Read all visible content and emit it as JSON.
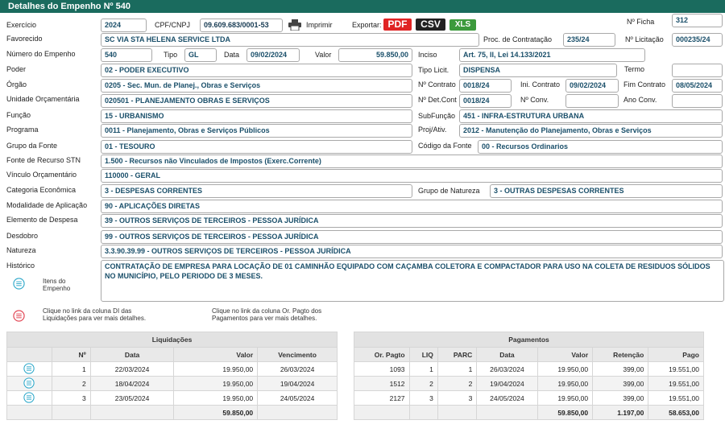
{
  "header": {
    "title": "Detalhes do Empenho Nº 540"
  },
  "row1": {
    "exercicio_label": "Exercício",
    "exercicio": "2024",
    "cnpj_label": "CPF/CNPJ",
    "cnpj": "09.609.683/0001-53",
    "imprimir": "Imprimir",
    "exportar": "Exportar:",
    "pdf": "PDF",
    "csv": "CSV",
    "xls": "XLS",
    "ficha_label": "Nº Ficha",
    "ficha": "312"
  },
  "row2": {
    "favorecido_label": "Favorecido",
    "favorecido": "SC VIA STA HELENA SERVICE LTDA",
    "proc_label": "Proc. de Contratação",
    "proc": "235/24",
    "licitacao_label": "Nº Licitação",
    "licitacao": "000235/24"
  },
  "row3": {
    "num_label": "Número do Empenho",
    "num": "540",
    "tipo_label": "Tipo",
    "tipo": "GL",
    "data_label": "Data",
    "data": "09/02/2024",
    "valor_label": "Valor",
    "valor": "59.850,00",
    "inciso_label": "Inciso",
    "inciso": "Art. 75, II, Lei 14.133/2021"
  },
  "row4": {
    "poder_label": "Poder",
    "poder": "02 - PODER EXECUTIVO",
    "tipolicit_label": "Tipo Licit.",
    "tipolicit": "DISPENSA",
    "termo_label": "Termo",
    "termo": ""
  },
  "row5": {
    "orgao_label": "Órgão",
    "orgao": "0205 - Sec. Mun. de Planej., Obras e Serviços",
    "contrato_label": "Nº Contrato",
    "contrato": "0018/24",
    "inicio_label": "Ini. Contrato",
    "inicio": "09/02/2024",
    "fim_label": "Fim Contrato",
    "fim": "08/05/2024"
  },
  "row6": {
    "unidade_label": "Unidade Orçamentária",
    "unidade": "020501 - PLANEJAMENTO OBRAS E SERVIÇOS",
    "detcont_label": "Nº Det.Cont",
    "detcont": "0018/24",
    "conv_label": "Nº Conv.",
    "conv": "",
    "anoconv_label": "Ano Conv.",
    "anoconv": ""
  },
  "row7": {
    "funcao_label": "Função",
    "funcao": "15 - URBANISMO",
    "subfuncao_label": "SubFunção",
    "subfuncao": "451 - INFRA-ESTRUTURA URBANA"
  },
  "row8": {
    "programa_label": "Programa",
    "programa": "0011 - Planejamento, Obras e Serviços Públicos",
    "projativ_label": "Proj/Ativ.",
    "projativ": "2012 - Manutenção do Planejamento, Obras e Serviços"
  },
  "row9": {
    "grupofonte_label": "Grupo da Fonte",
    "grupofonte": "01 - TESOURO",
    "codfonte_label": "Código da Fonte",
    "codfonte": "00 - Recursos Ordinarios"
  },
  "row10": {
    "fonte_label": "Fonte de Recurso STN",
    "fonte": "1.500 - Recursos não Vinculados de Impostos (Exerc.Corrente)"
  },
  "row11": {
    "vinculo_label": "Vínculo Orçamentário",
    "vinculo": "110000 - GERAL"
  },
  "row12": {
    "categoria_label": "Categoria Econômica",
    "categoria": "3 - DESPESAS CORRENTES",
    "grupnat_label": "Grupo de Natureza",
    "grupnat": "3 - OUTRAS DESPESAS CORRENTES"
  },
  "row13": {
    "modalidade_label": "Modalidade de Aplicação",
    "modalidade": "90 - APLICAÇÕES DIRETAS"
  },
  "row14": {
    "elemento_label": "Elemento de Despesa",
    "elemento": "39 - OUTROS SERVIÇOS DE TERCEIROS - PESSOA JURÍDICA"
  },
  "row15": {
    "desdobro_label": "Desdobro",
    "desdobro": "99 - OUTROS SERVIÇOS DE TERCEIROS - PESSOA JURÍDICA"
  },
  "row16": {
    "natureza_label": "Natureza",
    "natureza": "3.3.90.39.99 - OUTROS SERVIÇOS DE TERCEIROS - PESSOA JURÍDICA"
  },
  "row17": {
    "historico_label": "Histórico",
    "historico": "CONTRATAÇÃO DE EMPRESA PARA LOCAÇÃO DE 01 CAMINHÃO EQUIPADO COM CAÇAMBA COLETORA E COMPACTADOR PARA USO NA COLETA DE RESIDUOS SÓLIDOS NO MUNICÍPIO, PELO PERIODO DE 3 MESES."
  },
  "links": {
    "itens_line1": "Itens do",
    "itens_line2": "Empenho",
    "liq_hint_line1": "Clique no link da coluna DI das",
    "liq_hint_line2": "Liquidações para ver mais detalhes.",
    "pag_hint_line1": "Clique no link da coluna Or. Pagto dos",
    "pag_hint_line2": "Pagamentos para ver mais detalhes."
  },
  "liquidacoes": {
    "title": "Liquidações",
    "headers": [
      "",
      "Nº",
      "Data",
      "Valor",
      "Vencimento"
    ],
    "rows": [
      {
        "n": "1",
        "data": "22/03/2024",
        "valor": "19.950,00",
        "venc": "26/03/2024"
      },
      {
        "n": "2",
        "data": "18/04/2024",
        "valor": "19.950,00",
        "venc": "19/04/2024"
      },
      {
        "n": "3",
        "data": "23/05/2024",
        "valor": "19.950,00",
        "venc": "24/05/2024"
      }
    ],
    "total": "59.850,00"
  },
  "pagamentos": {
    "title": "Pagamentos",
    "headers": [
      "Or. Pagto",
      "LIQ",
      "PARC",
      "Data",
      "Valor",
      "Retenção",
      "Pago"
    ],
    "rows": [
      {
        "or": "1093",
        "liq": "1",
        "parc": "1",
        "data": "26/03/2024",
        "valor": "19.950,00",
        "ret": "399,00",
        "pago": "19.551,00"
      },
      {
        "or": "1512",
        "liq": "2",
        "parc": "2",
        "data": "19/04/2024",
        "valor": "19.950,00",
        "ret": "399,00",
        "pago": "19.551,00"
      },
      {
        "or": "2127",
        "liq": "3",
        "parc": "3",
        "data": "24/05/2024",
        "valor": "19.950,00",
        "ret": "399,00",
        "pago": "19.551,00"
      }
    ],
    "total_valor": "59.850,00",
    "total_ret": "1.197,00",
    "total_pago": "58.653,00"
  },
  "colors": {
    "header": "#1a6b5e",
    "field_text": "#1a4f6a",
    "pdf": "#e02424",
    "csv": "#222222",
    "xls": "#3c9a3c",
    "icon_teal": "#2ba7c9",
    "icon_red": "#e03b4a"
  }
}
